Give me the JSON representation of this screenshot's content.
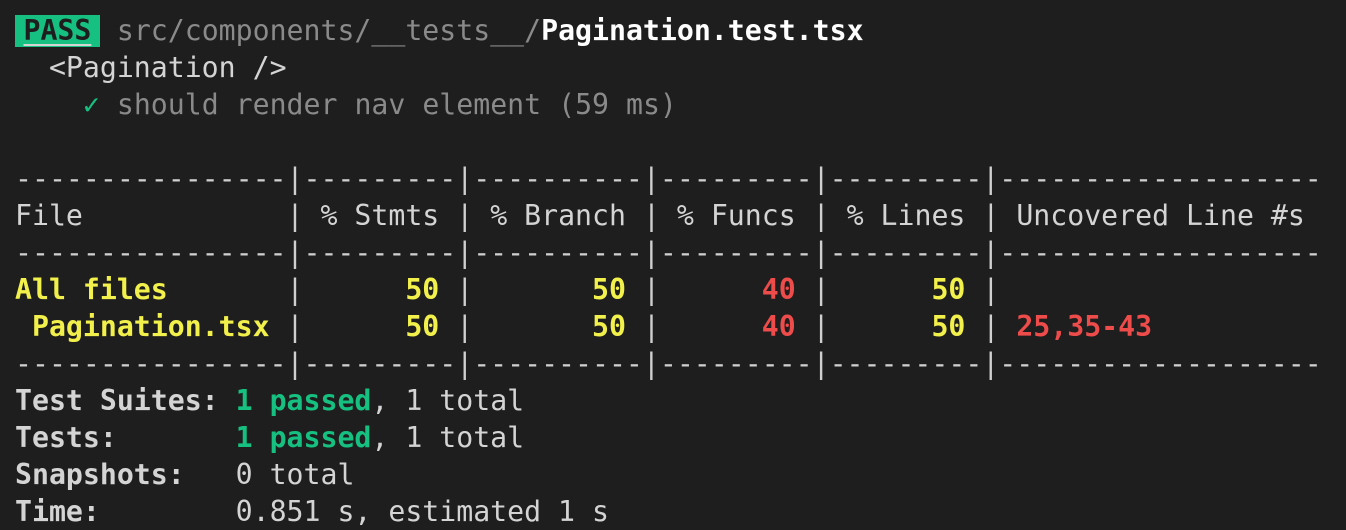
{
  "header": {
    "status_badge": "PASS",
    "path_dir": "src/components/__tests__/",
    "path_file": "Pagination.test.tsx"
  },
  "suite": {
    "describe": "<Pagination />",
    "tests": [
      {
        "check_icon": "✓",
        "name": "should render nav element",
        "duration": "(59 ms)"
      }
    ]
  },
  "coverage": {
    "separator": "----------------|---------|----------|---------|---------|-------------------",
    "columns": [
      "File",
      "% Stmts",
      "% Branch",
      "% Funcs",
      "% Lines",
      "Uncovered Line #s"
    ],
    "rows": [
      {
        "file": "All files",
        "stmts": "50",
        "branch": "50",
        "funcs": "40",
        "lines": "50",
        "uncovered": ""
      },
      {
        "file": "Pagination.tsx",
        "stmts": "50",
        "branch": "50",
        "funcs": "40",
        "lines": "50",
        "uncovered": "25,35-43"
      }
    ],
    "colors": {
      "ok": "#f2f04a",
      "low": "#ee4b4b"
    }
  },
  "summary": {
    "suites_label": "Test Suites:",
    "suites_passed": "1 passed",
    "suites_total": ", 1 total",
    "tests_label": "Tests:",
    "tests_passed": "1 passed",
    "tests_total": ", 1 total",
    "snapshots_label": "Snapshots:",
    "snapshots_value": "0 total",
    "time_label": "Time:",
    "time_value": "0.851 s, estimated 1 s"
  },
  "colors": {
    "pass": "#16c080",
    "background": "#1e1e1e"
  }
}
